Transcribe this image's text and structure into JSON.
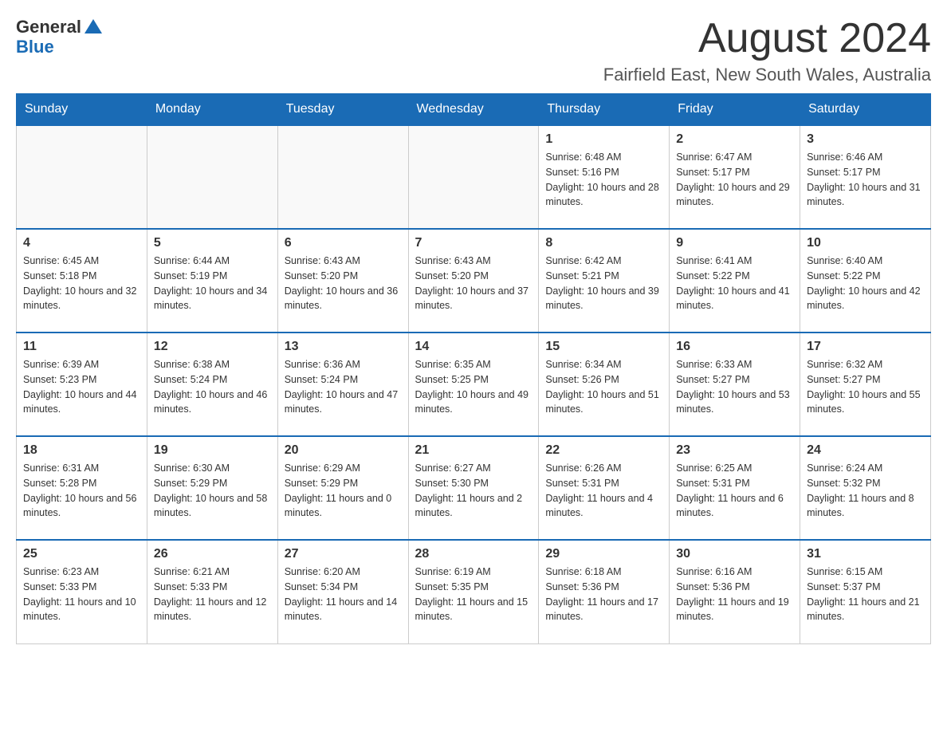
{
  "header": {
    "logo_general": "General",
    "logo_blue": "Blue",
    "month_year": "August 2024",
    "location": "Fairfield East, New South Wales, Australia"
  },
  "days_of_week": [
    "Sunday",
    "Monday",
    "Tuesday",
    "Wednesday",
    "Thursday",
    "Friday",
    "Saturday"
  ],
  "weeks": [
    [
      {
        "day": "",
        "info": ""
      },
      {
        "day": "",
        "info": ""
      },
      {
        "day": "",
        "info": ""
      },
      {
        "day": "",
        "info": ""
      },
      {
        "day": "1",
        "info": "Sunrise: 6:48 AM\nSunset: 5:16 PM\nDaylight: 10 hours and 28 minutes."
      },
      {
        "day": "2",
        "info": "Sunrise: 6:47 AM\nSunset: 5:17 PM\nDaylight: 10 hours and 29 minutes."
      },
      {
        "day": "3",
        "info": "Sunrise: 6:46 AM\nSunset: 5:17 PM\nDaylight: 10 hours and 31 minutes."
      }
    ],
    [
      {
        "day": "4",
        "info": "Sunrise: 6:45 AM\nSunset: 5:18 PM\nDaylight: 10 hours and 32 minutes."
      },
      {
        "day": "5",
        "info": "Sunrise: 6:44 AM\nSunset: 5:19 PM\nDaylight: 10 hours and 34 minutes."
      },
      {
        "day": "6",
        "info": "Sunrise: 6:43 AM\nSunset: 5:20 PM\nDaylight: 10 hours and 36 minutes."
      },
      {
        "day": "7",
        "info": "Sunrise: 6:43 AM\nSunset: 5:20 PM\nDaylight: 10 hours and 37 minutes."
      },
      {
        "day": "8",
        "info": "Sunrise: 6:42 AM\nSunset: 5:21 PM\nDaylight: 10 hours and 39 minutes."
      },
      {
        "day": "9",
        "info": "Sunrise: 6:41 AM\nSunset: 5:22 PM\nDaylight: 10 hours and 41 minutes."
      },
      {
        "day": "10",
        "info": "Sunrise: 6:40 AM\nSunset: 5:22 PM\nDaylight: 10 hours and 42 minutes."
      }
    ],
    [
      {
        "day": "11",
        "info": "Sunrise: 6:39 AM\nSunset: 5:23 PM\nDaylight: 10 hours and 44 minutes."
      },
      {
        "day": "12",
        "info": "Sunrise: 6:38 AM\nSunset: 5:24 PM\nDaylight: 10 hours and 46 minutes."
      },
      {
        "day": "13",
        "info": "Sunrise: 6:36 AM\nSunset: 5:24 PM\nDaylight: 10 hours and 47 minutes."
      },
      {
        "day": "14",
        "info": "Sunrise: 6:35 AM\nSunset: 5:25 PM\nDaylight: 10 hours and 49 minutes."
      },
      {
        "day": "15",
        "info": "Sunrise: 6:34 AM\nSunset: 5:26 PM\nDaylight: 10 hours and 51 minutes."
      },
      {
        "day": "16",
        "info": "Sunrise: 6:33 AM\nSunset: 5:27 PM\nDaylight: 10 hours and 53 minutes."
      },
      {
        "day": "17",
        "info": "Sunrise: 6:32 AM\nSunset: 5:27 PM\nDaylight: 10 hours and 55 minutes."
      }
    ],
    [
      {
        "day": "18",
        "info": "Sunrise: 6:31 AM\nSunset: 5:28 PM\nDaylight: 10 hours and 56 minutes."
      },
      {
        "day": "19",
        "info": "Sunrise: 6:30 AM\nSunset: 5:29 PM\nDaylight: 10 hours and 58 minutes."
      },
      {
        "day": "20",
        "info": "Sunrise: 6:29 AM\nSunset: 5:29 PM\nDaylight: 11 hours and 0 minutes."
      },
      {
        "day": "21",
        "info": "Sunrise: 6:27 AM\nSunset: 5:30 PM\nDaylight: 11 hours and 2 minutes."
      },
      {
        "day": "22",
        "info": "Sunrise: 6:26 AM\nSunset: 5:31 PM\nDaylight: 11 hours and 4 minutes."
      },
      {
        "day": "23",
        "info": "Sunrise: 6:25 AM\nSunset: 5:31 PM\nDaylight: 11 hours and 6 minutes."
      },
      {
        "day": "24",
        "info": "Sunrise: 6:24 AM\nSunset: 5:32 PM\nDaylight: 11 hours and 8 minutes."
      }
    ],
    [
      {
        "day": "25",
        "info": "Sunrise: 6:23 AM\nSunset: 5:33 PM\nDaylight: 11 hours and 10 minutes."
      },
      {
        "day": "26",
        "info": "Sunrise: 6:21 AM\nSunset: 5:33 PM\nDaylight: 11 hours and 12 minutes."
      },
      {
        "day": "27",
        "info": "Sunrise: 6:20 AM\nSunset: 5:34 PM\nDaylight: 11 hours and 14 minutes."
      },
      {
        "day": "28",
        "info": "Sunrise: 6:19 AM\nSunset: 5:35 PM\nDaylight: 11 hours and 15 minutes."
      },
      {
        "day": "29",
        "info": "Sunrise: 6:18 AM\nSunset: 5:36 PM\nDaylight: 11 hours and 17 minutes."
      },
      {
        "day": "30",
        "info": "Sunrise: 6:16 AM\nSunset: 5:36 PM\nDaylight: 11 hours and 19 minutes."
      },
      {
        "day": "31",
        "info": "Sunrise: 6:15 AM\nSunset: 5:37 PM\nDaylight: 11 hours and 21 minutes."
      }
    ]
  ]
}
